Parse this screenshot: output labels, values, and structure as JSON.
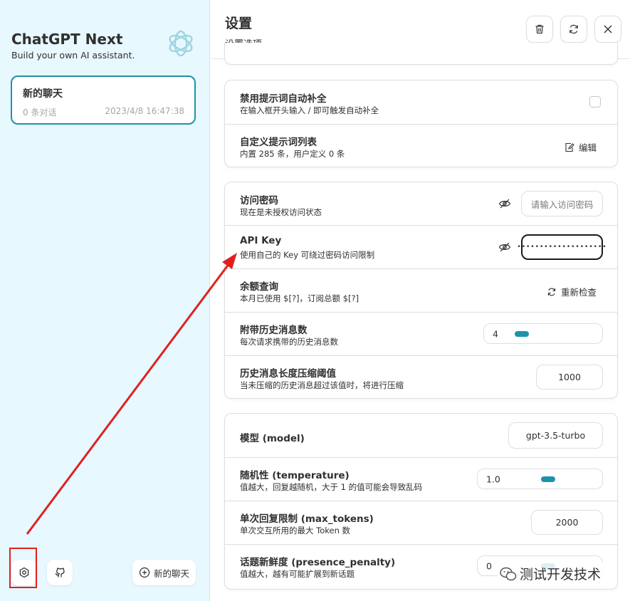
{
  "sidebar": {
    "app_title": "ChatGPT Next",
    "app_subtitle": "Build your own AI assistant.",
    "chat_item": {
      "title": "新的聊天",
      "count": "0 条对话",
      "time": "2023/4/8 16:47:38"
    },
    "new_chat_label": "新的聊天"
  },
  "header": {
    "title": "设置",
    "subtitle": "设置选项"
  },
  "settings": {
    "prompt_group": [
      {
        "title": "禁用提示词自动补全",
        "desc": "在输入框开头输入 / 即可触发自动补全"
      },
      {
        "title": "自定义提示词列表",
        "desc": "内置 285 条，用户定义 0 条",
        "action": "编辑"
      }
    ],
    "access_group": [
      {
        "title": "访问密码",
        "desc": "现在是未授权访问状态",
        "placeholder": "请输入访问密码"
      },
      {
        "title": "API Key",
        "desc": "使用自己的 Key 可绕过密码访问限制",
        "value": "••••••••••••••••••••"
      },
      {
        "title": "余额查询",
        "desc": "本月已使用 $[?]，订阅总额 $[?]",
        "action": "重新检查"
      },
      {
        "title": "附带历史消息数",
        "desc": "每次请求携带的历史消息数",
        "value": "4",
        "level": 0.2
      },
      {
        "title": "历史消息长度压缩阈值",
        "desc": "当未压缩的历史消息超过该值时，将进行压缩",
        "value": "1000"
      }
    ],
    "model_group": [
      {
        "title": "模型 (model)",
        "value": "gpt-3.5-turbo"
      },
      {
        "title": "随机性 (temperature)",
        "desc": "值越大，回复越随机，大于 1 的值可能会导致乱码",
        "value": "1.0",
        "level": 0.5
      },
      {
        "title": "单次回复限制 (max_tokens)",
        "desc": "单次交互所用的最大 Token 数",
        "value": "2000"
      },
      {
        "title": "话题新鲜度 (presence_penalty)",
        "desc": "值越大，越有可能扩展到新话题",
        "value": "0"
      }
    ]
  },
  "watermark": "测试开发技术",
  "colors": {
    "accent": "#1d93ab",
    "sidebar_bg": "#e7f8ff",
    "annotation": "#e02020"
  }
}
